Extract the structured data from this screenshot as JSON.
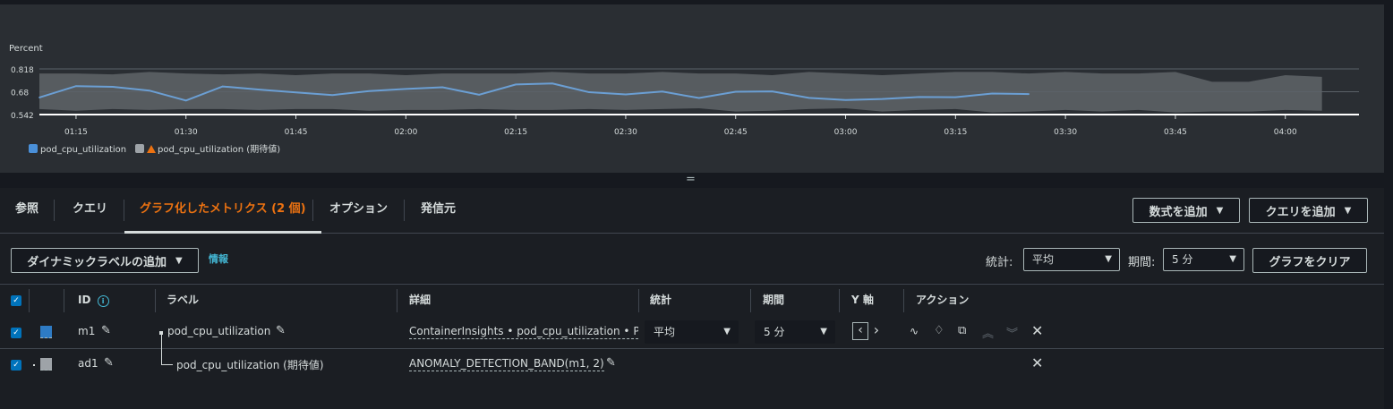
{
  "chart": {
    "unit_label": "Percent",
    "y_ticks": [
      "0.818",
      "0.68",
      "0.542"
    ],
    "x_ticks": [
      "01:15",
      "01:30",
      "01:45",
      "02:00",
      "02:15",
      "02:30",
      "02:45",
      "03:00",
      "03:15",
      "03:30",
      "03:45",
      "04:00"
    ],
    "legend": [
      {
        "name": "pod_cpu_utilization",
        "color": "#4a90d9"
      },
      {
        "name": "pod_cpu_utilization (期待値)",
        "color": "#9ea3a8",
        "warning": true
      }
    ]
  },
  "chart_data": {
    "type": "line",
    "ylabel": "Percent",
    "ylim": [
      0.542,
      0.818
    ],
    "x": [
      "01:10",
      "01:15",
      "01:20",
      "01:25",
      "01:30",
      "01:35",
      "01:40",
      "01:45",
      "01:50",
      "01:55",
      "02:00",
      "02:05",
      "02:10",
      "02:15",
      "02:20",
      "02:25",
      "02:30",
      "02:35",
      "02:40",
      "02:45",
      "02:50",
      "02:55",
      "03:00",
      "03:05",
      "03:10",
      "03:15",
      "03:20",
      "03:25"
    ],
    "series": [
      {
        "name": "pod_cpu_utilization",
        "color": "#6b9fd4",
        "values": [
          0.645,
          0.714,
          0.71,
          0.687,
          0.627,
          0.712,
          0.693,
          0.676,
          0.66,
          0.684,
          0.697,
          0.707,
          0.662,
          0.724,
          0.73,
          0.677,
          0.664,
          0.681,
          0.642,
          0.68,
          0.682,
          0.643,
          0.63,
          0.636,
          0.648,
          0.647,
          0.669,
          0.666
        ]
      }
    ],
    "band": {
      "name": "pod_cpu_utilization (期待値)",
      "x": [
        "01:10",
        "01:15",
        "01:20",
        "01:25",
        "01:30",
        "01:35",
        "01:40",
        "01:45",
        "01:50",
        "01:55",
        "02:00",
        "02:05",
        "02:10",
        "02:15",
        "02:20",
        "02:25",
        "02:30",
        "02:35",
        "02:40",
        "02:45",
        "02:50",
        "02:55",
        "03:00",
        "03:05",
        "03:10",
        "03:15",
        "03:20",
        "03:25",
        "03:30",
        "03:35",
        "03:40",
        "03:45",
        "03:50",
        "03:55",
        "04:00",
        "04:05"
      ],
      "upper": [
        0.79,
        0.79,
        0.785,
        0.8,
        0.79,
        0.785,
        0.79,
        0.78,
        0.79,
        0.79,
        0.78,
        0.79,
        0.79,
        0.79,
        0.8,
        0.79,
        0.79,
        0.8,
        0.79,
        0.79,
        0.78,
        0.8,
        0.79,
        0.78,
        0.79,
        0.8,
        0.8,
        0.79,
        0.8,
        0.79,
        0.79,
        0.8,
        0.74,
        0.74,
        0.78,
        0.77
      ],
      "lower": [
        0.575,
        0.565,
        0.575,
        0.57,
        0.575,
        0.575,
        0.57,
        0.575,
        0.575,
        0.565,
        0.57,
        0.57,
        0.575,
        0.57,
        0.57,
        0.575,
        0.57,
        0.575,
        0.58,
        0.56,
        0.565,
        0.575,
        0.58,
        0.56,
        0.57,
        0.575,
        0.555,
        0.56,
        0.57,
        0.56,
        0.57,
        0.555,
        0.56,
        0.56,
        0.57,
        0.565
      ],
      "color": "#5f6468"
    }
  },
  "tabs": [
    "参照",
    "クエリ",
    "グラフ化したメトリクス (2 個)",
    "オプション",
    "発信元"
  ],
  "buttons": {
    "add_math": "数式を追加",
    "add_query": "クエリを追加",
    "add_dynamic_label": "ダイナミックラベルの追加",
    "clear_graph": "グラフをクリア"
  },
  "info_link": "情報",
  "controls": {
    "stat_label": "統計:",
    "stat_value": "平均",
    "period_label": "期間:",
    "period_value": "5 分"
  },
  "columns": {
    "id": "ID",
    "label": "ラベル",
    "details": "詳細",
    "stat": "統計",
    "period": "期間",
    "y_axis": "Y 軸",
    "actions": "アクション"
  },
  "rows": [
    {
      "id": "m1",
      "color": "#2e7bc4",
      "label": "pod_cpu_utilization",
      "details": "ContainerInsights • pod_cpu_utilization • Pod",
      "stat": "平均",
      "period": "5 分"
    },
    {
      "id": "ad1",
      "color": "#9ea3a8",
      "label": "pod_cpu_utilization (期待値)",
      "details": "ANOMALY_DETECTION_BAND(m1, 2)"
    }
  ]
}
